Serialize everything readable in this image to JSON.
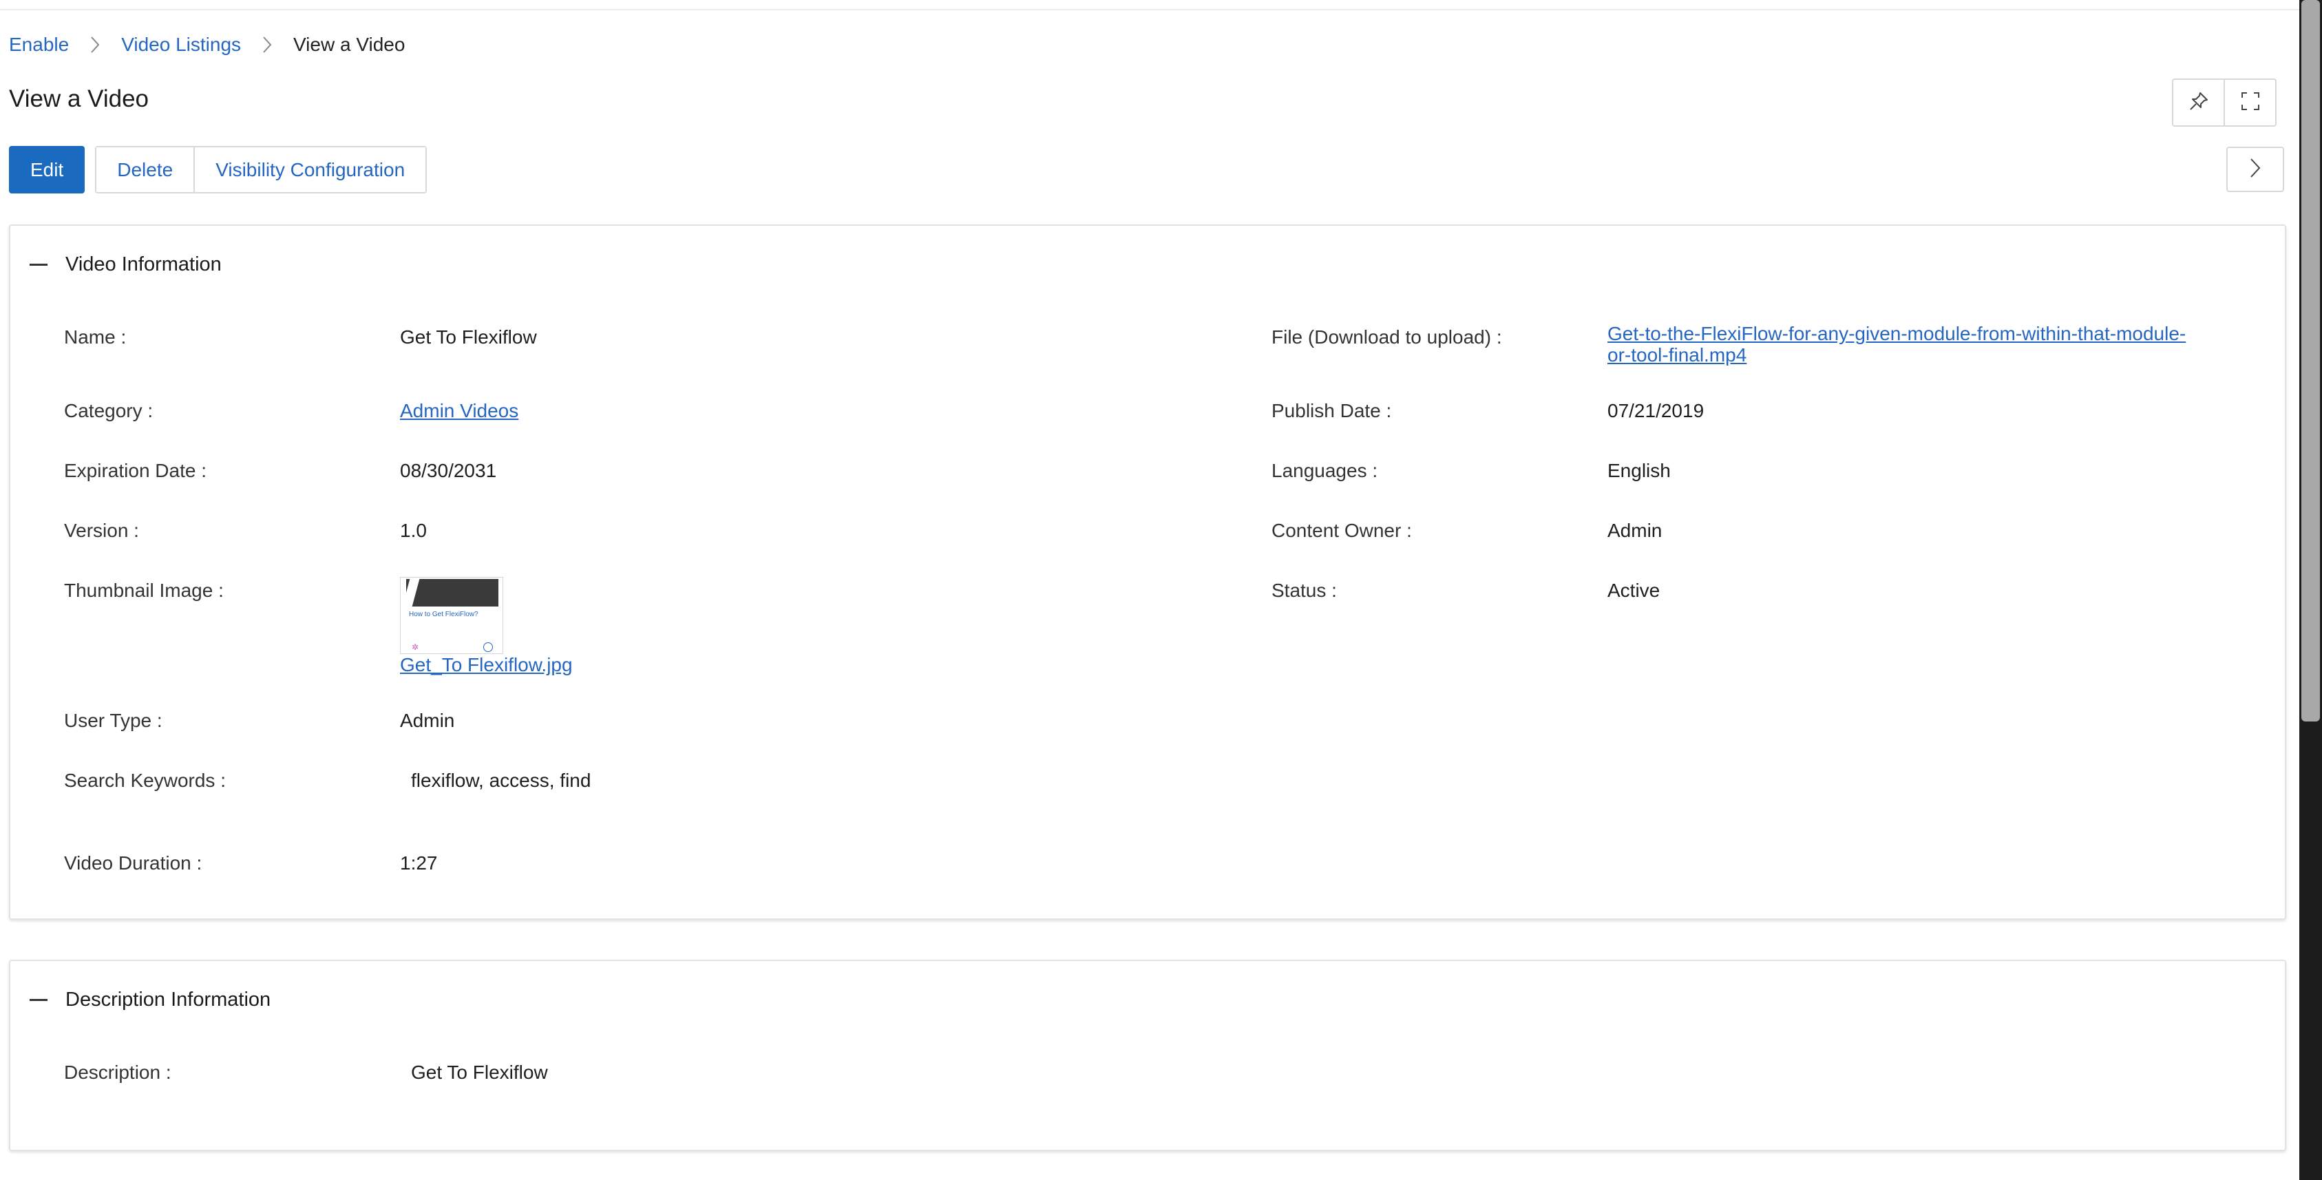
{
  "breadcrumb": {
    "items": [
      "Enable",
      "Video Listings"
    ],
    "current": "View a Video"
  },
  "page_title": "View a Video",
  "toolbar": {
    "edit_label": "Edit",
    "delete_label": "Delete",
    "visibility_label": "Visibility Configuration"
  },
  "icons": {
    "pin": "pin-icon",
    "expand": "fullscreen-icon",
    "next": "chevron-right-icon",
    "collapse": "minus-icon"
  },
  "colors": {
    "link": "#2466c2",
    "primary_button": "#1a6bbf"
  },
  "video_info": {
    "title": "Video Information",
    "name_label": "Name :",
    "name_value": "Get To Flexiflow",
    "file_label": "File (Download to upload) :",
    "file_value_line1": "Get-to-the-FlexiFlow-for-any-given-module-from-within-that-module-",
    "file_value_line2": "or-tool-final.mp4",
    "category_label": "Category :",
    "category_value": "Admin Videos",
    "publish_label": "Publish Date :",
    "publish_value": "07/21/2019",
    "expiration_label": "Expiration Date :",
    "expiration_value": "08/30/2031",
    "languages_label": "Languages :",
    "languages_value": "English",
    "version_label": "Version :",
    "version_value": "1.0",
    "owner_label": "Content Owner :",
    "owner_value": "Admin",
    "thumbnail_label": "Thumbnail Image :",
    "thumbnail_file": "Get_To Flexiflow.jpg",
    "thumbnail_caption": "How to Get FlexiFlow?",
    "status_label": "Status :",
    "status_value": "Active",
    "user_type_label": "User Type :",
    "user_type_value": "Admin",
    "keywords_label": "Search Keywords :",
    "keywords_value": "flexiflow, access, find",
    "duration_label": "Video Duration :",
    "duration_value": "1:27"
  },
  "description_info": {
    "title": "Description Information",
    "description_label": "Description :",
    "description_value": "Get To Flexiflow"
  }
}
